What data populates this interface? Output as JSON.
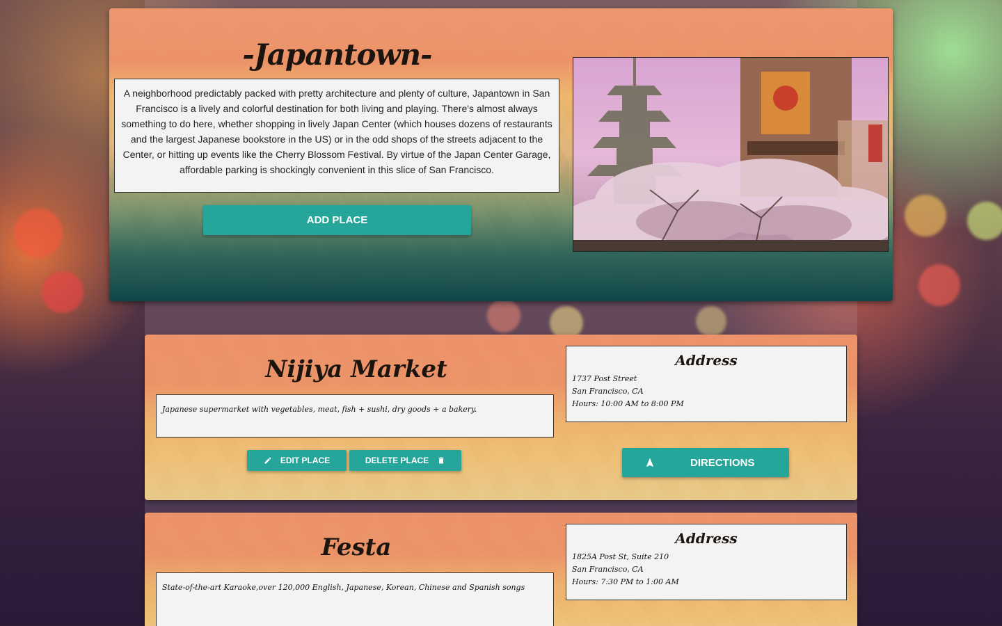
{
  "hero": {
    "title": "-Japantown-",
    "description": "A neighborhood predictably packed with pretty architecture and plenty of culture, Japantown in San Francisco is a lively and colorful destination for both living and playing. There's almost always something to do here, whether shopping in lively Japan Center (which houses dozens of restaurants and the largest Japanese bookstore in the US) or in the odd shops of the streets adjacent to the Center, or hitting up events like the Cherry Blossom Festival. By virtue of the Japan Center Garage, affordable parking is shockingly convenient in this slice of San Francisco.",
    "add_place_label": "ADD PLACE",
    "photo_icon": "pagoda-photo"
  },
  "places": [
    {
      "name": "Nijiya Market",
      "description": "Japanese supermarket with vegetables, meat, fish + sushi, dry goods + a bakery.",
      "address_heading": "Address",
      "street": "1737 Post Street",
      "city": "San Francisco, CA",
      "hours": "Hours: 10:00 AM to 8:00 PM",
      "edit_label": "EDIT PLACE",
      "delete_label": "DELETE PLACE",
      "directions_label": "DIRECTIONS"
    },
    {
      "name": "Festa",
      "description": "State-of-the-art Karaoke,over 120,000 English, Japanese, Korean, Chinese and Spanish songs",
      "address_heading": "Address",
      "street": "1825A Post St, Suite 210",
      "city": "San Francisco, CA",
      "hours": "Hours: 7:30 PM to 1:00 AM"
    }
  ],
  "colors": {
    "accent": "#26a69a",
    "card_orange": "#ec936a",
    "hero_teal_dark": "#104648"
  }
}
